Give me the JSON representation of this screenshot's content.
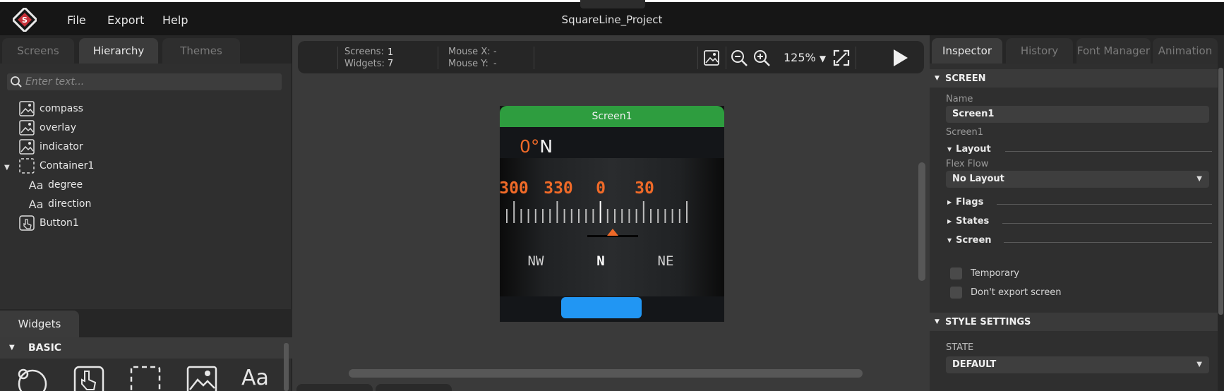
{
  "app": {
    "title": "SquareLine_Project",
    "menu": [
      "File",
      "Export",
      "Help"
    ]
  },
  "left_panel": {
    "tabs": [
      "Screens",
      "Hierarchy",
      "Themes"
    ],
    "active_tab": "Hierarchy",
    "search_placeholder": "Enter text...",
    "hierarchy": [
      {
        "label": "compass",
        "icon": "image-icon"
      },
      {
        "label": "overlay",
        "icon": "image-icon"
      },
      {
        "label": "indicator",
        "icon": "image-icon"
      },
      {
        "label": "Container1",
        "icon": "container-icon",
        "expanded": true
      },
      {
        "label": "degree",
        "icon": "label-icon",
        "glyph": "Aa"
      },
      {
        "label": "direction",
        "icon": "label-icon",
        "glyph": "Aa"
      },
      {
        "label": "Button1",
        "icon": "button-icon"
      }
    ],
    "widgets_tab": "Widgets",
    "basic_section": "BASIC",
    "widget_icons": [
      "arc-icon",
      "button-icon",
      "container-icon",
      "image-icon",
      "label-icon"
    ],
    "label_glyph": "Aa"
  },
  "canvas": {
    "stats": {
      "screens_label": "Screens:",
      "screens_value": "1",
      "widgets_label": "Widgets:",
      "widgets_value": "7",
      "mouse_x_label": "Mouse X:",
      "mouse_x_value": "-",
      "mouse_y_label": "Mouse Y:",
      "mouse_y_value": "-"
    },
    "zoom": "125%",
    "zoom_arrow": "▼",
    "screen_name": "Screen1",
    "preview": {
      "heading": "0°N",
      "heading_color": "#f06a28",
      "scale_numbers": [
        "300",
        "330",
        "0",
        "30"
      ],
      "scale_color": "#f06a28",
      "directions": [
        "NW",
        "N",
        "NE"
      ],
      "button_color": "#2196f3"
    }
  },
  "inspector": {
    "tabs": [
      "Inspector",
      "History",
      "Font Manager",
      "Animation"
    ],
    "active_tab": "Inspector",
    "screen_section": "SCREEN",
    "name_label": "Name",
    "name_value": "Screen1",
    "type_label": "Screen1",
    "layout_label": "Layout",
    "flex_flow_label": "Flex Flow",
    "flex_flow_value": "No Layout",
    "flags_label": "Flags",
    "states_label": "States",
    "screen_sub_label": "Screen",
    "checkboxes": [
      "Temporary",
      "Don't export screen"
    ],
    "style_section": "STYLE SETTINGS",
    "state_label": "STATE",
    "state_value": "DEFAULT"
  }
}
